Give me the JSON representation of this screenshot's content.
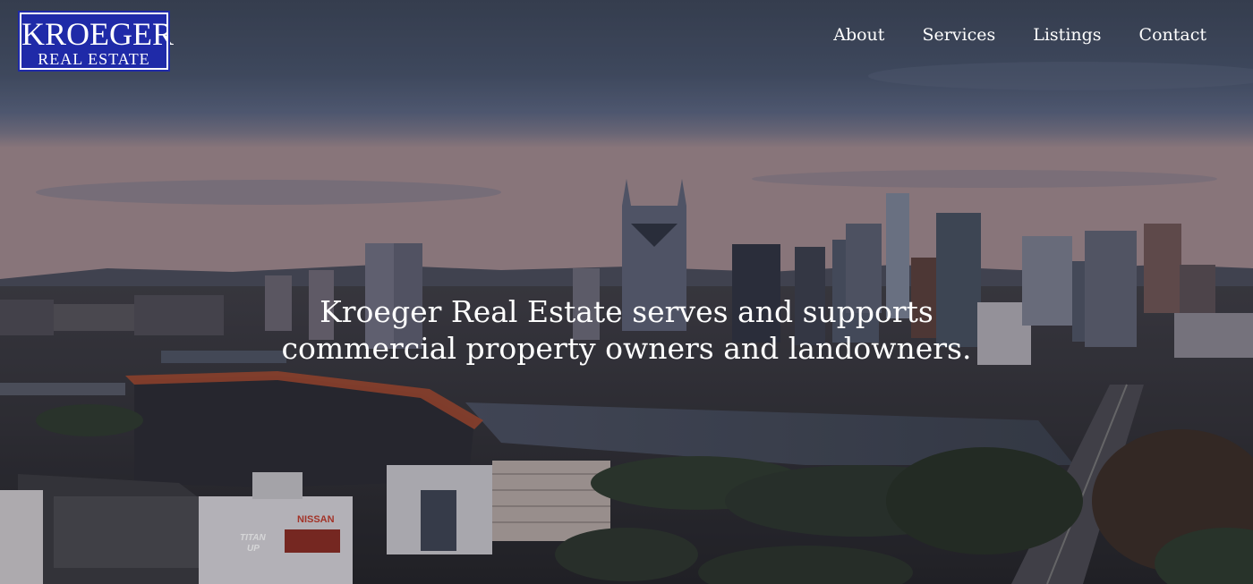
{
  "logo": {
    "line1": "KROEGER",
    "line2": "REAL ESTATE",
    "color": "#1f2aa8"
  },
  "nav": {
    "items": [
      {
        "label": "About"
      },
      {
        "label": "Services"
      },
      {
        "label": "Listings"
      },
      {
        "label": "Contact"
      }
    ]
  },
  "hero": {
    "line1": "Kroeger Real Estate serves and supports",
    "line2": "commercial property owners and landowners.",
    "background": "city-skyline-photo"
  },
  "billboard": {
    "brand": "NISSAN",
    "slogan1": "TITAN",
    "slogan2": "UP"
  }
}
